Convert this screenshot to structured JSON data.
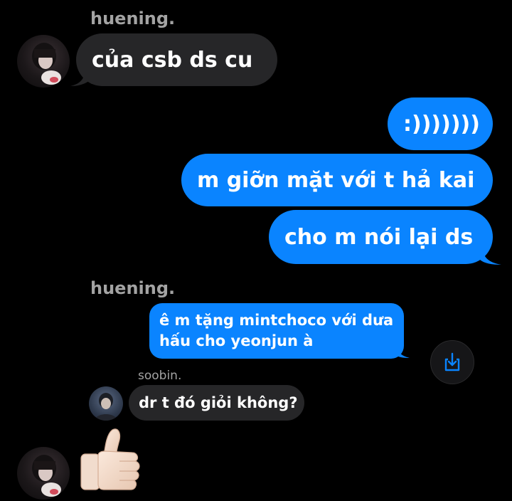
{
  "messages": {
    "sender1": "huening.",
    "msg1": "của csb ds cu",
    "out1": ":)))))))",
    "out2": "m giỡn mặt với t hả kai",
    "out3": "cho m nói lại ds",
    "sender2": "huening.",
    "reply_line1": "ê m tặng mintchoco với dưa",
    "reply_line2": "hấu cho yeonjun à",
    "sender3": "soobin.",
    "msg_soobin": "dr t đó giỏi không?",
    "reaction": "👍🏻"
  },
  "icons": {
    "share": "share-download-icon",
    "avatar_huening": "avatar-huening",
    "avatar_soobin": "avatar-soobin"
  },
  "colors": {
    "background": "#000000",
    "incoming_bubble": "#262628",
    "outgoing_bubble": "#0a84ff",
    "sender_name": "#a3a3a3"
  }
}
